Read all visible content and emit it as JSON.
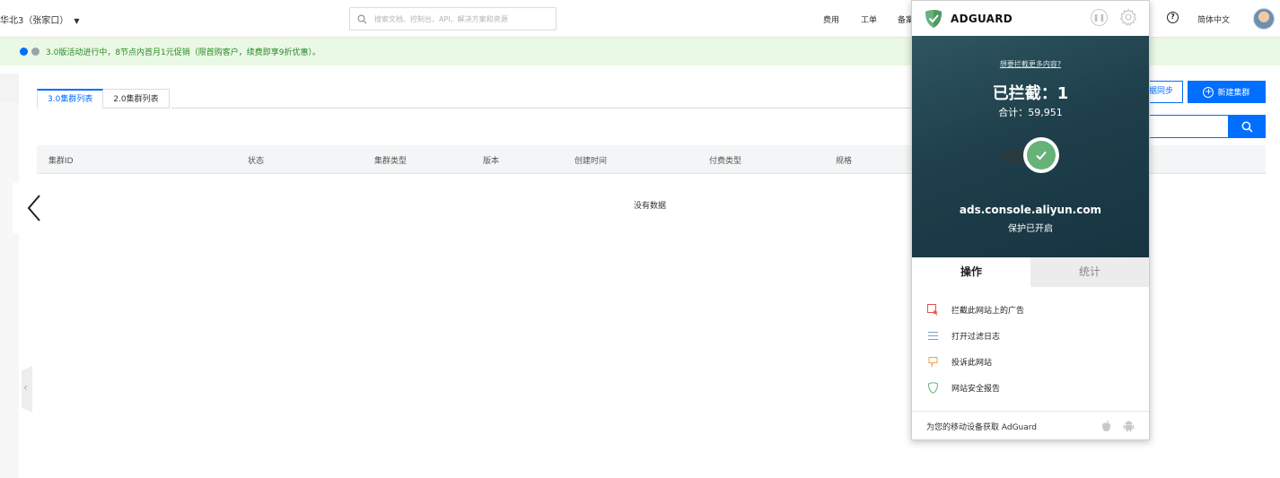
{
  "header": {
    "region": "华北3（张家口）",
    "search_placeholder": "搜索文档、控制台、API、解决方案和资源",
    "links": [
      "费用",
      "工单",
      "备案"
    ],
    "language": "简体中文"
  },
  "promo": {
    "text": "3.0版活动进行中，8节点内首月1元促销（限首购客户，续费即享9折优惠）。",
    "dot_colors": [
      "#006eff",
      "#9aa3aa"
    ]
  },
  "tabs": [
    "3.0集群列表",
    "2.0集群列表"
  ],
  "table": {
    "columns": [
      "集群ID",
      "状态",
      "集群类型",
      "版本",
      "创建时间",
      "付费类型",
      "规格"
    ],
    "empty_text": "没有数据"
  },
  "actions": {
    "sync_label": "据同步",
    "new_cluster_label": "新建集群"
  },
  "adguard": {
    "brand": "ADGUARD",
    "more_link": "想要拦截更多内容?",
    "blocked_label": "已拦截：1",
    "total_label": "合计：59,951",
    "domain": "ads.console.aliyun.com",
    "status": "保护已开启",
    "tabs": [
      "操作",
      "统计"
    ],
    "menu": [
      {
        "label": "拦截此网站上的广告",
        "icon": "block-ad-icon",
        "color": "#e4524b"
      },
      {
        "label": "打开过滤日志",
        "icon": "filter-log-icon",
        "color": "#7a9fd0"
      },
      {
        "label": "投诉此网站",
        "icon": "report-site-icon",
        "color": "#f2a33a"
      },
      {
        "label": "网站安全报告",
        "icon": "security-report-icon",
        "color": "#67b279"
      }
    ],
    "footer": "为您的移动设备获取 AdGuard",
    "accent_color": "#67b279"
  }
}
